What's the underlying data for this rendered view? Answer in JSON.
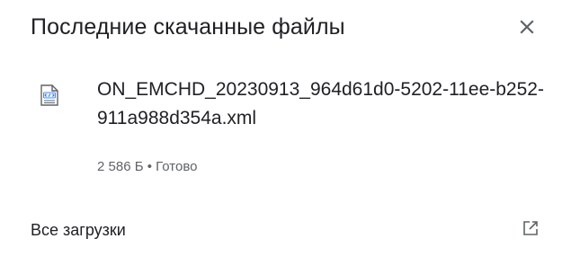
{
  "panel": {
    "title": "Последние скачанные файлы",
    "close_icon": "close-icon"
  },
  "download": {
    "icon": "xml-file-icon",
    "file_name": "ON_EMCHD_20230913_964d61d0-5202-11ee-b252-911a988d354a.xml",
    "size": "2 586 Б",
    "separator": "•",
    "status": "Готово"
  },
  "footer": {
    "all_downloads_label": "Все загрузки",
    "open_icon": "open-in-new-icon"
  },
  "colors": {
    "text": "#202124",
    "secondary_text": "#5f6368",
    "icon": "#5f6368",
    "file_icon_accent": "#1a73e8"
  }
}
